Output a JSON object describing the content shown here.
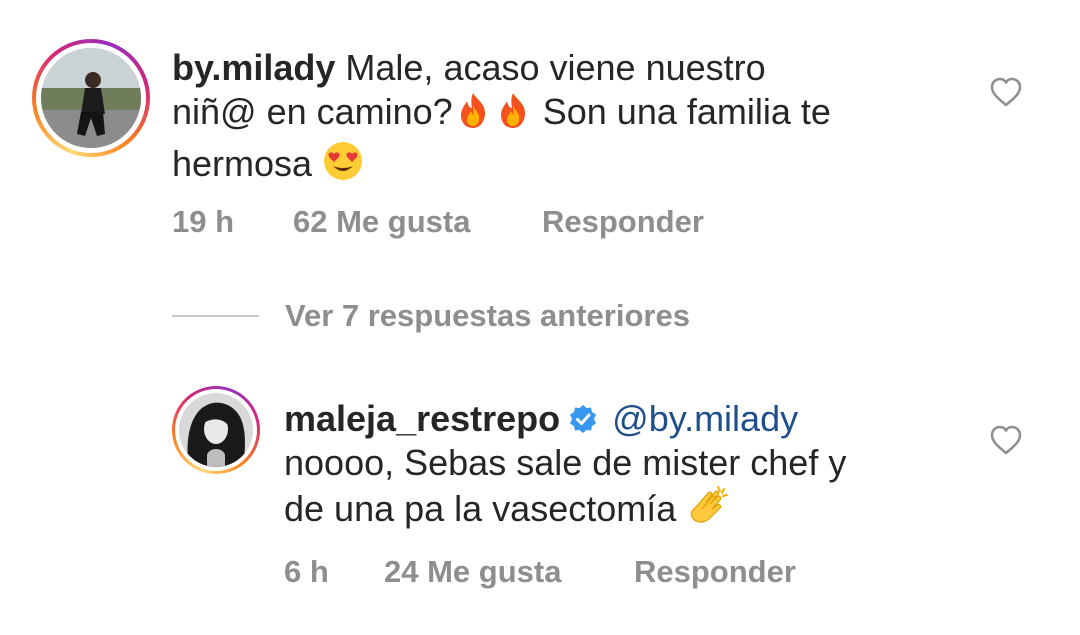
{
  "comment1": {
    "username": "by.milady",
    "text_line1": "Male, acaso viene nuestro",
    "text_line2_a": "niñ@ en camino?",
    "text_line2_b": "Son una familia te",
    "text_line3": "hermosa",
    "time": "19 h",
    "likes": "62 Me gusta",
    "reply_label": "Responder",
    "avatar_icon": "profile-photo"
  },
  "view_replies": {
    "label": "Ver 7 respuestas anteriores"
  },
  "comment2": {
    "username": "maleja_restrepo",
    "verified_icon": "verified-badge-icon",
    "mention": "@by.milady",
    "text_line1": "noooo, Sebas sale de mister chef y",
    "text_line2": "de una pa la vasectomía",
    "time": "6 h",
    "likes": "24 Me gusta",
    "reply_label": "Responder",
    "avatar_icon": "profile-photo"
  },
  "colors": {
    "text": "#262626",
    "meta": "#8e8e8e",
    "mention": "#1e4f8c",
    "verified": "#3897f0"
  }
}
